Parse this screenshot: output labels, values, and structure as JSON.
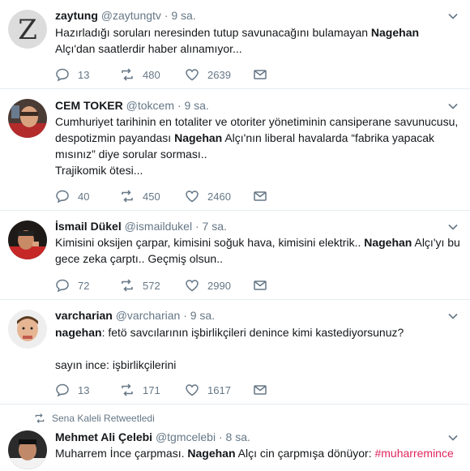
{
  "tweets": [
    {
      "name": "zaytung",
      "handle": "@zaytungtv",
      "time": "9 sa.",
      "text_pre": "Hazırladığı soruları neresinden tutup savunacağını bulamayan ",
      "text_bold": "Nagehan",
      "text_post": " Alçı'dan saatlerdir haber alınamıyor...",
      "replies": "13",
      "retweets": "480",
      "likes": "2639"
    },
    {
      "name": "CEM TOKER",
      "handle": "@tokcem",
      "time": "9 sa.",
      "text_pre": "Cumhuriyet tarihinin en totaliter ve otoriter yönetiminin cansiperane savunucusu, despotizmin payandası ",
      "text_bold": "Nagehan",
      "text_post": " Alçı'nın liberal havalarda “fabrika yapacak mısınız” diye sorular sorması..",
      "text_line2": "Trajikomik ötesi...",
      "replies": "40",
      "retweets": "450",
      "likes": "2460"
    },
    {
      "name": "İsmail Dükel",
      "handle": "@ismaildukel",
      "time": "7 sa.",
      "text_pre": "Kimisini oksijen çarpar, kimisini soğuk hava, kimisini elektrik.. ",
      "text_bold": "Nagehan",
      "text_post": " Alçı'yı bu gece zeka çarptı.. Geçmiş olsun..",
      "replies": "72",
      "retweets": "572",
      "likes": "2990"
    },
    {
      "name": "varcharian",
      "handle": "@varcharian",
      "time": "9 sa.",
      "text_pre": "",
      "text_bold": "nagehan",
      "text_post": ": fetö savcılarının işbirlikçileri denince kimi kastediyorsunuz?",
      "text_line2": "sayın ince: işbirlikçilerini",
      "replies": "13",
      "retweets": "171",
      "likes": "1617"
    },
    {
      "retweeted_by": "Sena Kaleli Retweetledi",
      "name": "Mehmet Ali Çelebi",
      "handle": "@tgmcelebi",
      "time": "8 sa.",
      "text_pre": "Muharrem İnce çarpması. ",
      "text_bold": "Nagehan",
      "text_post": " Alçı cin çarpmışa dönüyor: ",
      "hashtag": "#muharremince"
    }
  ],
  "dot": "·",
  "colors": {
    "hashtag": "#e0245e",
    "muted": "#657786",
    "divider": "#e6ecf0"
  },
  "icons": [
    "reply-icon",
    "retweet-icon",
    "like-icon",
    "message-icon",
    "chevron-down-icon"
  ]
}
